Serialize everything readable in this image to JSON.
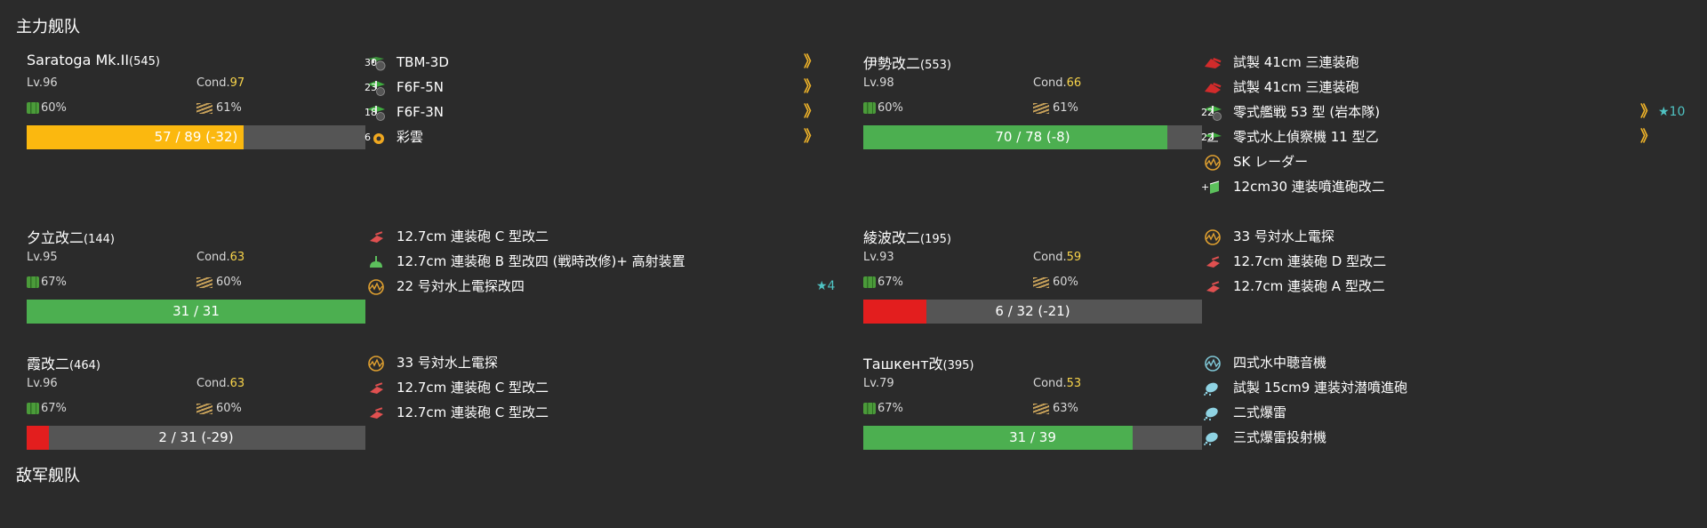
{
  "sections": {
    "main_fleet": "主力舰队",
    "enemy_fleet": "敌军舰队"
  },
  "labels": {
    "lv_prefix": "Lv.",
    "cond_prefix": "Cond."
  },
  "colors": {
    "hp_green": "#4caf50",
    "hp_orange": "#fbb80f",
    "hp_red": "#e31e1e",
    "cond_yellow": "#f7d34a",
    "chevron": "#f0b429",
    "star": "#4fc3c3"
  },
  "ships": [
    {
      "name": "Saratoga Mk.II",
      "id": "(545)",
      "lv": "96",
      "cond": "97",
      "fuel": "60%",
      "ammo": "61%",
      "hp_text": "57 / 89 (-32)",
      "hp_ratio": 0.6404,
      "hp_color": "#fbb80f",
      "equips": [
        {
          "name": "TBM-3D",
          "icon": "torpedo-bomber-icon",
          "slot": "30",
          "chevron": "》"
        },
        {
          "name": "F6F-5N",
          "icon": "fighter-icon",
          "slot": "23",
          "chevron": "》"
        },
        {
          "name": "F6F-3N",
          "icon": "fighter-icon",
          "slot": "18",
          "chevron": "》"
        },
        {
          "name": "彩雲",
          "icon": "recon-plane-icon",
          "slot": "6",
          "chevron": "》"
        }
      ]
    },
    {
      "name": "伊勢改二",
      "id": "(553)",
      "lv": "98",
      "cond": "66",
      "fuel": "60%",
      "ammo": "61%",
      "hp_text": "70 / 78 (-8)",
      "hp_ratio": 0.8974,
      "hp_color": "#4caf50",
      "equips": [
        {
          "name": "試製 41cm 三連装砲",
          "icon": "large-gun-icon"
        },
        {
          "name": "試製 41cm 三連装砲",
          "icon": "large-gun-icon"
        },
        {
          "name": "零式艦戦 53 型 (岩本隊)",
          "icon": "fighter-icon",
          "slot": "22",
          "chevron": "》",
          "star": "★10"
        },
        {
          "name": "零式水上偵察機 11 型乙",
          "icon": "seaplane-icon",
          "slot": "22",
          "chevron": "》"
        },
        {
          "name": "SK レーダー",
          "icon": "radar-icon"
        },
        {
          "name": "12cm30 連装噴進砲改二",
          "icon": "rocket-launcher-icon",
          "slot": "+"
        }
      ]
    },
    {
      "name": "夕立改二",
      "id": "(144)",
      "lv": "95",
      "cond": "63",
      "fuel": "67%",
      "ammo": "60%",
      "hp_text": "31 / 31",
      "hp_ratio": 1.0,
      "hp_color": "#4caf50",
      "equips": [
        {
          "name": "12.7cm 連装砲 C 型改二",
          "icon": "small-gun-icon"
        },
        {
          "name": "12.7cm 連装砲 B 型改四 (戦時改修)+ 高射装置",
          "icon": "aa-gun-icon"
        },
        {
          "name": "22 号対水上電探改四",
          "icon": "radar-icon",
          "star": "★4"
        }
      ]
    },
    {
      "name": "綾波改二",
      "id": "(195)",
      "lv": "93",
      "cond": "59",
      "fuel": "67%",
      "ammo": "60%",
      "hp_text": "6 / 32 (-21)",
      "hp_ratio": 0.1875,
      "hp_color": "#e31e1e",
      "equips": [
        {
          "name": "33 号対水上電探",
          "icon": "radar-icon"
        },
        {
          "name": "12.7cm 連装砲 D 型改二",
          "icon": "small-gun-icon"
        },
        {
          "name": "12.7cm 連装砲 A 型改二",
          "icon": "small-gun-icon"
        }
      ]
    },
    {
      "name": "霞改二",
      "id": "(464)",
      "lv": "96",
      "cond": "63",
      "fuel": "67%",
      "ammo": "60%",
      "hp_text": "2 / 31 (-29)",
      "hp_ratio": 0.0645,
      "hp_color": "#e31e1e",
      "equips": [
        {
          "name": "33 号対水上電探",
          "icon": "radar-icon"
        },
        {
          "name": "12.7cm 連装砲 C 型改二",
          "icon": "small-gun-icon"
        },
        {
          "name": "12.7cm 連装砲 C 型改二",
          "icon": "small-gun-icon"
        }
      ]
    },
    {
      "name": "Ташкент改",
      "id": "(395)",
      "lv": "79",
      "cond": "53",
      "fuel": "67%",
      "ammo": "63%",
      "hp_text": "31 / 39",
      "hp_ratio": 0.7949,
      "hp_color": "#4caf50",
      "equips": [
        {
          "name": "四式水中聴音機",
          "icon": "sonar-icon"
        },
        {
          "name": "試製 15cm9 連装対潜噴進砲",
          "icon": "depth-charge-icon"
        },
        {
          "name": "二式爆雷",
          "icon": "depth-charge-icon"
        },
        {
          "name": "三式爆雷投射機",
          "icon": "depth-charge-icon"
        }
      ]
    }
  ]
}
